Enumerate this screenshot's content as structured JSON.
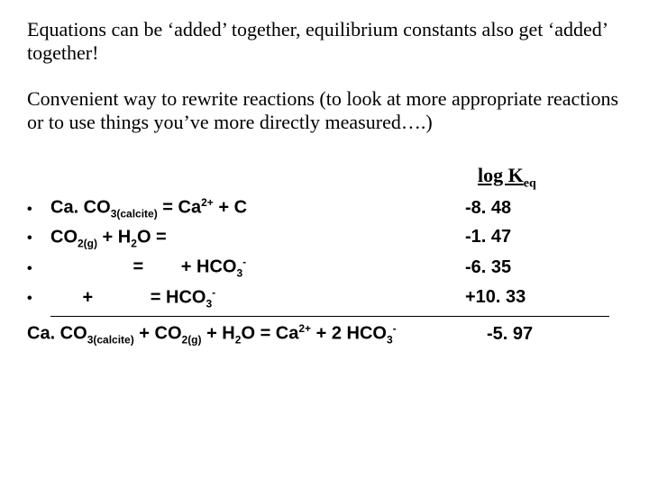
{
  "intro": {
    "p1": "Equations can be ‘added’ together, equilibrium constants also get ‘added’ together!",
    "p2": "Convenient way to rewrite reactions (to look at more appropriate reactions or to use things you’ve more directly measured….)"
  },
  "header": {
    "label_prefix": "log K",
    "label_sub": "eq"
  },
  "rows": [
    {
      "eq_pre": "Ca. CO",
      "eq_sub1": "3(calcite)",
      "eq_mid": " = Ca",
      "eq_sup1": "2+",
      "eq_post": " + ",
      "mask_visible_char": "C",
      "value": "-8. 48"
    },
    {
      "eq_pre": "CO",
      "eq_sub1": "2(g)",
      "eq_mid": " + H",
      "eq_sub2": "2",
      "eq_post": "O = ",
      "value": "-1. 47"
    },
    {
      "eq_mid1": " = ",
      "eq_mid2": "+ HCO",
      "eq_sub": "3",
      "eq_sup": "-",
      "value": "-6. 35"
    },
    {
      "eq_plus": " + ",
      "eq_eq": "= HCO",
      "eq_sub": "3",
      "eq_sup": "-",
      "value": "+10. 33"
    }
  ],
  "result": {
    "p1": "Ca. CO",
    "s1": "3(calcite)",
    "p2": " + CO",
    "s2": "2(g)",
    "p3": " + H",
    "s3": "2",
    "p4": "O = Ca",
    "sp1": "2+",
    "p5": " + 2 HCO",
    "s4": "3",
    "sp2": "-",
    "value": "-5. 97"
  }
}
